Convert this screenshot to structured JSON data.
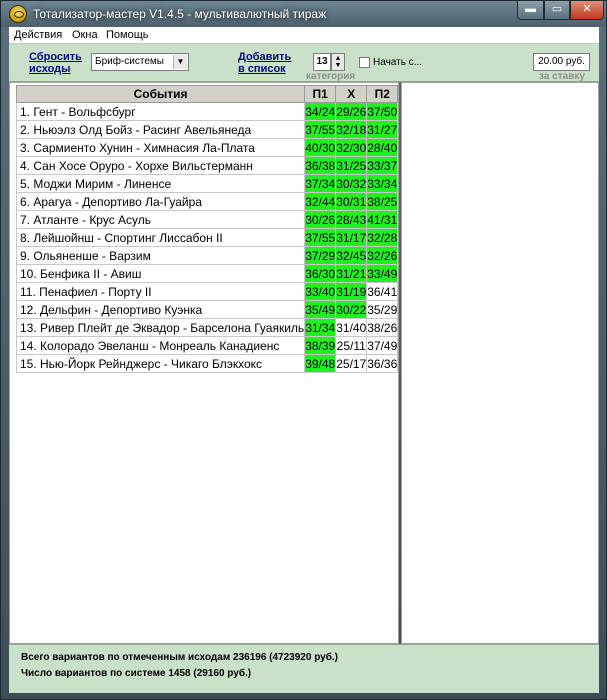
{
  "window": {
    "title": "Тотализатор-мастер V1.4.5 - мультивалютный тираж",
    "min_glyph": "▬",
    "max_glyph": "▭",
    "close_glyph": "✕"
  },
  "menu": {
    "items": [
      "Действия",
      "Окна",
      "Помощь"
    ]
  },
  "toolbar": {
    "reset_line1": "Сбросить",
    "reset_line2": "исходы",
    "system_value": "Бриф-системы",
    "add_line1": "Добавить",
    "add_line2": "в список",
    "category_value": "13",
    "category_label": "категория",
    "start_label": "Начать с...",
    "stake_value": "20.00 руб.",
    "stake_label": "за ставку"
  },
  "table": {
    "headers": [
      "События",
      "П1",
      "Х",
      "П2"
    ],
    "rows": [
      {
        "event": "1. Гент - Вольфсбург",
        "p1": "34/24",
        "x": "29/26",
        "p2": "37/50",
        "sel": [
          true,
          true,
          true
        ]
      },
      {
        "event": "2. Ньюэлз Олд Бойз - Расинг Авельянеда",
        "p1": "37/55",
        "x": "32/18",
        "p2": "31/27",
        "sel": [
          true,
          true,
          true
        ]
      },
      {
        "event": "3. Сармиенто Хунин - Химнасия Ла-Плата",
        "p1": "40/30",
        "x": "32/30",
        "p2": "28/40",
        "sel": [
          true,
          true,
          true
        ]
      },
      {
        "event": "4. Сан Хосе Оруро - Хорхе Вильстерманн",
        "p1": "36/38",
        "x": "31/25",
        "p2": "33/37",
        "sel": [
          true,
          true,
          true
        ]
      },
      {
        "event": "5. Моджи Мирим - Линенсе",
        "p1": "37/34",
        "x": "30/32",
        "p2": "33/34",
        "sel": [
          true,
          true,
          true
        ]
      },
      {
        "event": "6. Арагуа - Депортиво Ла-Гуайра",
        "p1": "32/44",
        "x": "30/31",
        "p2": "38/25",
        "sel": [
          true,
          true,
          true
        ]
      },
      {
        "event": "7. Атланте - Крус Асуль",
        "p1": "30/26",
        "x": "28/43",
        "p2": "41/31",
        "sel": [
          true,
          true,
          true
        ]
      },
      {
        "event": "8. Лейшойнш - Спортинг Лиссабон II",
        "p1": "37/55",
        "x": "31/17",
        "p2": "32/28",
        "sel": [
          true,
          true,
          true
        ]
      },
      {
        "event": "9. Ольяненше - Варзим",
        "p1": "37/29",
        "x": "32/45",
        "p2": "32/26",
        "sel": [
          true,
          true,
          true
        ]
      },
      {
        "event": "10. Бенфика II - Авиш",
        "p1": "36/30",
        "x": "31/21",
        "p2": "33/49",
        "sel": [
          true,
          true,
          true
        ]
      },
      {
        "event": "11. Пенафиел - Порту II",
        "p1": "33/40",
        "x": "31/19",
        "p2": "36/41",
        "sel": [
          true,
          true,
          false
        ]
      },
      {
        "event": "12. Дельфин - Депортиво Куэнка",
        "p1": "35/49",
        "x": "30/22",
        "p2": "35/29",
        "sel": [
          true,
          true,
          false
        ]
      },
      {
        "event": "13. Ривер Плейт де Эквадор - Барселона Гуаякиль",
        "p1": "31/34",
        "x": "31/40",
        "p2": "38/26",
        "sel": [
          true,
          false,
          false
        ]
      },
      {
        "event": "14. Колорадо Эвеланш - Монреаль Канадиенс",
        "p1": "38/39",
        "x": "25/11",
        "p2": "37/49",
        "sel": [
          true,
          false,
          false
        ]
      },
      {
        "event": "15. Нью-Йорк Рейнджерс - Чикаго Блэкхокс",
        "p1": "39/48",
        "x": "25/17",
        "p2": "36/36",
        "sel": [
          true,
          false,
          false
        ]
      }
    ]
  },
  "status": {
    "line1": "Всего вариантов по отмеченным исходам 236196 (4723920 руб.)",
    "line2": "Число вариантов по системе 1458 (29160 руб.)"
  },
  "colors": {
    "selected_cell": "#20f020",
    "panel_green": "#c9e0c9",
    "link_blue": "#000b80"
  }
}
